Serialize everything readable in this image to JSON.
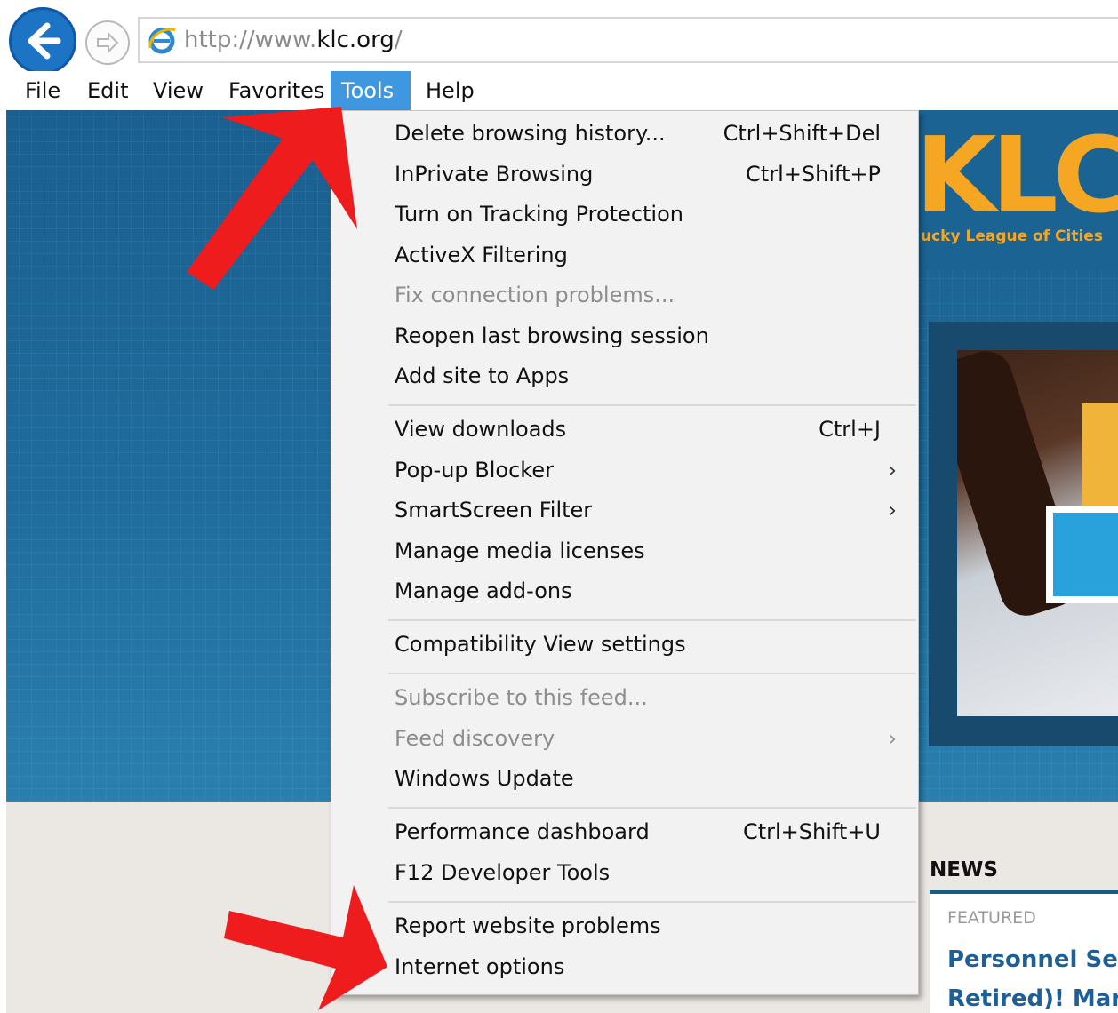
{
  "address_bar": {
    "url_prefix": "http://www.",
    "url_domain": "klc.org",
    "url_suffix": "/"
  },
  "menubar": {
    "items": [
      {
        "label": "File"
      },
      {
        "label": "Edit"
      },
      {
        "label": "View"
      },
      {
        "label": "Favorites"
      },
      {
        "label": "Tools",
        "active": true
      },
      {
        "label": "Help"
      }
    ]
  },
  "tools_menu": {
    "items": [
      {
        "label": "Delete browsing history...",
        "shortcut": "Ctrl+Shift+Del"
      },
      {
        "label": "InPrivate Browsing",
        "shortcut": "Ctrl+Shift+P"
      },
      {
        "label": "Turn on Tracking Protection"
      },
      {
        "label": "ActiveX Filtering"
      },
      {
        "label": "Fix connection problems...",
        "disabled": true
      },
      {
        "label": "Reopen last browsing session"
      },
      {
        "label": "Add site to Apps"
      },
      {
        "label": "View downloads",
        "shortcut": "Ctrl+J"
      },
      {
        "label": "Pop-up Blocker",
        "submenu": true
      },
      {
        "label": "SmartScreen Filter",
        "submenu": true
      },
      {
        "label": "Manage media licenses"
      },
      {
        "label": "Manage add-ons"
      },
      {
        "label": "Compatibility View settings"
      },
      {
        "label": "Subscribe to this feed...",
        "disabled": true
      },
      {
        "label": "Feed discovery",
        "disabled": true,
        "submenu": true
      },
      {
        "label": "Windows Update"
      },
      {
        "label": "Performance dashboard",
        "shortcut": "Ctrl+Shift+U"
      },
      {
        "label": "F12 Developer Tools"
      },
      {
        "label": "Report website problems"
      },
      {
        "label": "Internet options"
      }
    ],
    "submenu_glyph": "›"
  },
  "site": {
    "logo_letters": "KLC",
    "logo_tagline": "ucky League of Cities",
    "news_heading": "NEWS",
    "featured_label": "FEATURED",
    "news_title_line1": "Personnel Ser",
    "news_title_line2": "Retired)! Marc"
  },
  "colors": {
    "hero_blue": "#1f6c9c",
    "menu_highlight": "#3f97e0",
    "logo_orange": "#f5a623",
    "annotation_red": "#ee1c1c"
  },
  "icons": {
    "back": "back-arrow-icon",
    "forward": "forward-arrow-icon",
    "browser": "internet-explorer-icon"
  }
}
